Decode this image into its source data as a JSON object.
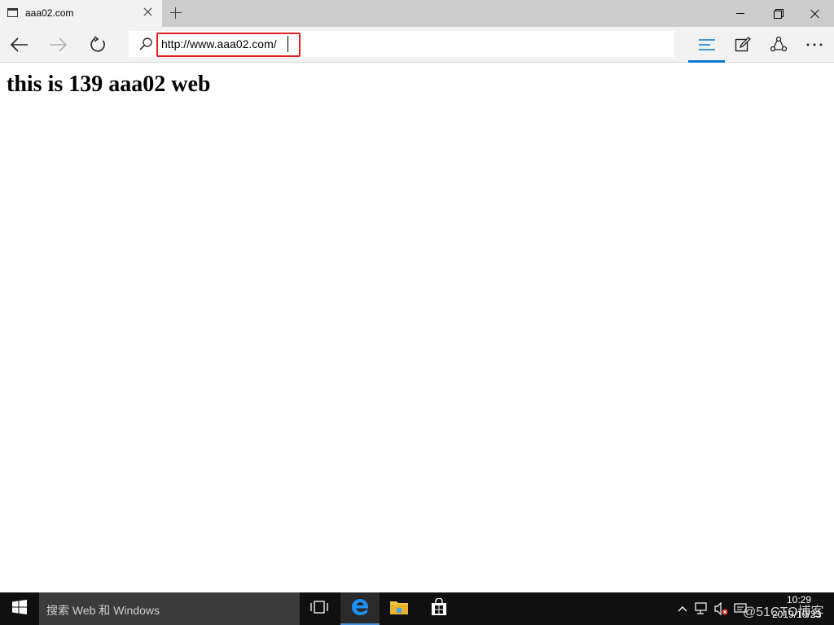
{
  "tab": {
    "title": "aaa02.com"
  },
  "address_bar": {
    "url": "http://www.aaa02.com/"
  },
  "page": {
    "heading": "this is 139 aaa02 web"
  },
  "taskbar": {
    "search_placeholder": "搜索 Web 和 Windows",
    "watermark": "@51CTO博客",
    "time": "10:29",
    "date": "2019/10/23"
  },
  "colors": {
    "accent": "#0078d7",
    "highlight_border": "#e02020",
    "taskbar_bg": "#101010",
    "tabstrip_bg": "#cccccc"
  },
  "icons": {
    "tab": [
      "tab-favicon-icon",
      "close-icon",
      "plus-icon"
    ],
    "window": [
      "minimize-icon",
      "restore-icon",
      "close-icon"
    ],
    "nav": [
      "back-arrow-icon",
      "forward-arrow-icon",
      "refresh-icon",
      "search-icon",
      "hub-icon",
      "web-note-icon",
      "share-icon",
      "more-icon"
    ],
    "taskbar": [
      "windows-logo-icon",
      "task-view-icon",
      "edge-icon",
      "file-explorer-icon",
      "store-icon",
      "chevron-up-icon",
      "network-icon",
      "volume-muted-icon",
      "notification-icon"
    ]
  }
}
